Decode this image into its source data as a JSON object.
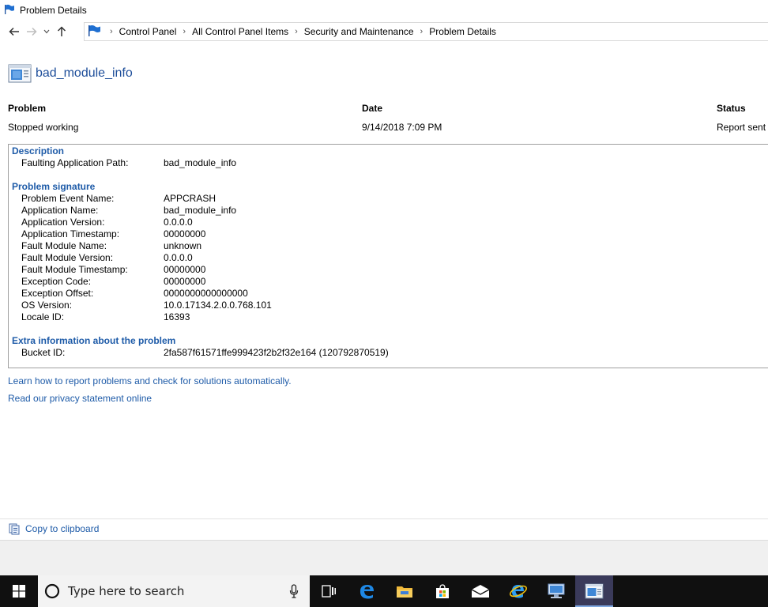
{
  "window": {
    "title": "Problem Details"
  },
  "address": {
    "crumbs": [
      "Control Panel",
      "All Control Panel Items",
      "Security and Maintenance",
      "Problem Details"
    ]
  },
  "app": {
    "name": "bad_module_info"
  },
  "summary": {
    "problem_header": "Problem",
    "date_header": "Date",
    "status_header": "Status",
    "problem_value": "Stopped working",
    "date_value": "9/14/2018 7:09 PM",
    "status_value": "Report sent"
  },
  "description": {
    "title": "Description",
    "rows": [
      {
        "key": "Faulting Application Path:",
        "value": "bad_module_info"
      }
    ]
  },
  "signature": {
    "title": "Problem signature",
    "rows": [
      {
        "key": "Problem Event Name:",
        "value": "APPCRASH"
      },
      {
        "key": "Application Name:",
        "value": "bad_module_info"
      },
      {
        "key": "Application Version:",
        "value": "0.0.0.0"
      },
      {
        "key": "Application Timestamp:",
        "value": "00000000"
      },
      {
        "key": "Fault Module Name:",
        "value": "unknown"
      },
      {
        "key": "Fault Module Version:",
        "value": "0.0.0.0"
      },
      {
        "key": "Fault Module Timestamp:",
        "value": "00000000"
      },
      {
        "key": "Exception Code:",
        "value": "00000000"
      },
      {
        "key": "Exception Offset:",
        "value": "0000000000000000"
      },
      {
        "key": "OS Version:",
        "value": "10.0.17134.2.0.0.768.101"
      },
      {
        "key": "Locale ID:",
        "value": "16393"
      }
    ]
  },
  "extra": {
    "title": "Extra information about the problem",
    "rows": [
      {
        "key": "Bucket ID:",
        "value": "2fa587f61571ffe999423f2b2f32e164 (120792870519)"
      }
    ]
  },
  "links": {
    "learn": "Learn how to report problems and check for solutions automatically.",
    "privacy": "Read our privacy statement online"
  },
  "copy": {
    "label": "Copy to clipboard"
  },
  "taskbar": {
    "search_placeholder": "Type here to search"
  },
  "colors": {
    "link": "#1e5ba8",
    "taskbar": "#101010",
    "accent": "#1e4e9a"
  }
}
